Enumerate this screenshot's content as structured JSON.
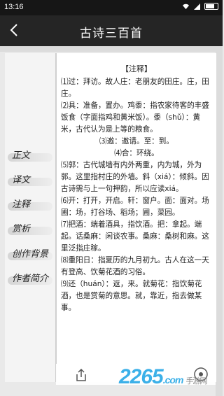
{
  "status": {
    "time": "13:16"
  },
  "app": {
    "title": "古诗三百首"
  },
  "menu": [
    {
      "label": "正文"
    },
    {
      "label": "译文"
    },
    {
      "label": "注释"
    },
    {
      "label": "赏析"
    },
    {
      "label": "创作背景"
    },
    {
      "label": "作者简介"
    }
  ],
  "content": {
    "header": "【注释】",
    "notes": [
      "⑴过：拜访。故人庄：老朋友的田庄。庄，田庄。",
      "⑵具：准备，置办。鸡黍：指农家待客的丰盛饭食（字面指鸡和黄米饭）。黍（shǔ）：黄米，古代认为是上等的粮食。",
      "⑶邀：邀请。至：到。",
      "⑷合：环绕。",
      "⑸郭：古代城墙有内外两重，内为城，外为郭。这里指村庄的外墙。斜（xiá）：倾斜。因古诗需与上一句押韵，所以应读xiá。",
      "⑹开：打开，开启。轩：窗户。面：面对。场圃：场，打谷场、稻场；圃，菜园。",
      "⑺把酒：端着酒具，指饮酒。把：拿起。端起。话桑麻：闲谈农事。桑麻：桑树和麻。这里泛指庄稼。",
      "⑻重阳日：指夏历的九月初九。古人在这一天有登高、饮菊花酒的习俗。",
      "⑼还（huán）：返，来。就菊花：指饮菊花酒，也是赏菊的意思。就，靠近，指去做某事。"
    ]
  },
  "watermark": {
    "brand": "2265",
    "suffix": ".com",
    "site": "手游网"
  },
  "colors": {
    "appbar": "#252525",
    "statusbar": "#161616",
    "watermark": "#3bb0e8"
  }
}
